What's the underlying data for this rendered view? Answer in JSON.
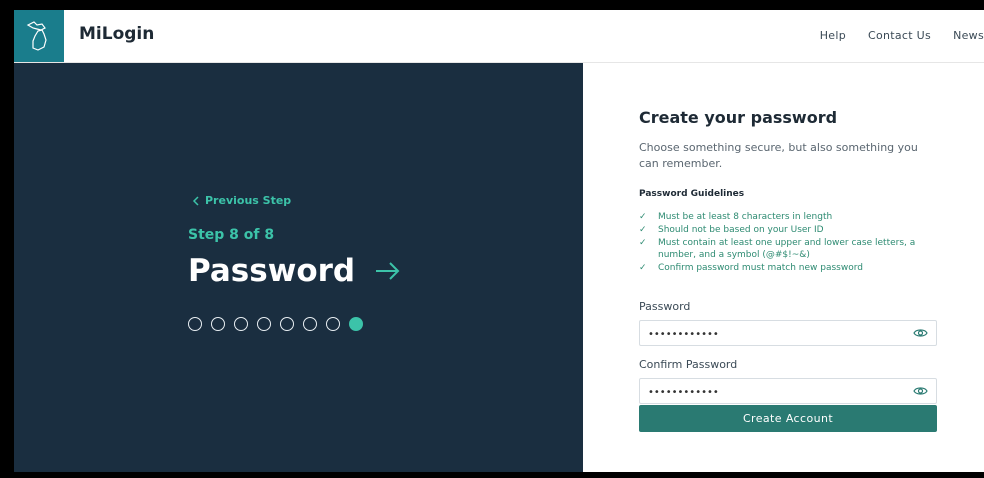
{
  "header": {
    "brand": "MiLogin",
    "nav": [
      "Help",
      "Contact Us",
      "News"
    ]
  },
  "left": {
    "previous_step": "Previous Step",
    "step_label": "Step 8 of 8",
    "title": "Password",
    "progress": {
      "total": 8,
      "current": 8
    }
  },
  "form": {
    "title": "Create your password",
    "subtitle": "Choose something secure, but also something you can remember.",
    "guidelines_heading": "Password Guidelines",
    "guidelines": [
      "Must be at least 8 characters in length",
      "Should not be based on your User ID",
      "Must contain at least one upper and lower case letters, a number, and a symbol (@#$!~&)",
      "Confirm password must match new password"
    ],
    "password_label": "Password",
    "password_value": "••••••••••••",
    "confirm_label": "Confirm Password",
    "confirm_value": "••••••••••••",
    "submit_label": "Create Account"
  },
  "colors": {
    "accent": "#3cc3a9",
    "panel": "#1a2e40",
    "button": "#2a7a72",
    "logo_bg": "#1a7d8c"
  },
  "icons": [
    "michigan-map-icon",
    "chevron-left-icon",
    "arrow-right-icon",
    "check-icon",
    "eye-icon"
  ]
}
